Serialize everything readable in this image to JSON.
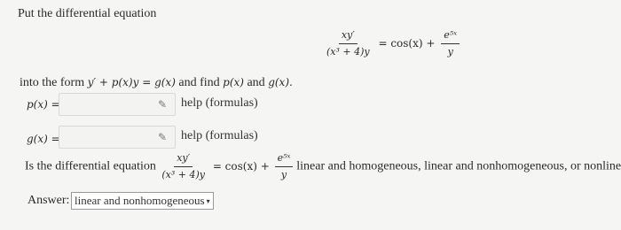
{
  "intro": "Put the differential equation",
  "equation": {
    "numerator": "xy′",
    "denominator": "(x³ + 4)y",
    "rhs_eq": "= cos(x) +",
    "rhs_num": "e⁵ˣ",
    "rhs_den": "y"
  },
  "instruction": {
    "text_before": "into the form",
    "form": "y′ + p(x)y = g(x)",
    "text_after": "and find",
    "p": "p(x)",
    "and": "and",
    "g": "g(x)."
  },
  "fields": [
    {
      "label": "p(x) =",
      "value": "",
      "help": "help (formulas)"
    },
    {
      "label": "g(x) =",
      "value": "",
      "help": "help (formulas)"
    }
  ],
  "question": {
    "text_before": "Is the differential equation",
    "numerator": "xy′",
    "denominator": "(x³ + 4)y",
    "rhs_eq": "= cos(x) +",
    "rhs_num": "e⁵ˣ",
    "rhs_den": "y",
    "text_after": "linear and homogeneous, linear and nonhomogeneous, or nonlinear?"
  },
  "answer": {
    "label": "Answer:",
    "selected": "linear and nonhomogeneous"
  },
  "icons": {
    "pencil": "pencil-icon",
    "dropdown": "chevron-down-icon"
  }
}
